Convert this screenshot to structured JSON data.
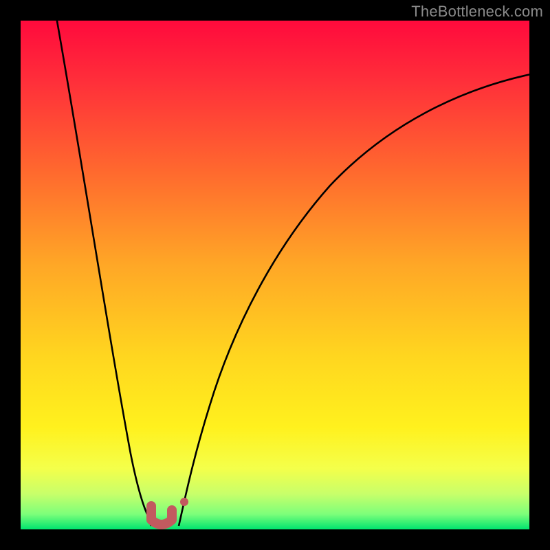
{
  "watermark": "TheBottleneck.com",
  "chart_data": {
    "type": "line",
    "title": "",
    "xlabel": "",
    "ylabel": "",
    "xlim": [
      0,
      100
    ],
    "ylim": [
      0,
      100
    ],
    "grid": false,
    "legend": null,
    "annotations": [],
    "background": {
      "style": "vertical-gradient",
      "meaning": "bottleneck severity (top=red=high, bottom=green=none)",
      "stops": [
        {
          "pos": 0.0,
          "color": "#ff0a3c"
        },
        {
          "pos": 0.12,
          "color": "#ff2f3a"
        },
        {
          "pos": 0.3,
          "color": "#ff6a2e"
        },
        {
          "pos": 0.48,
          "color": "#ffa726"
        },
        {
          "pos": 0.66,
          "color": "#ffd61f"
        },
        {
          "pos": 0.8,
          "color": "#fff11e"
        },
        {
          "pos": 0.88,
          "color": "#f4ff4a"
        },
        {
          "pos": 0.93,
          "color": "#c8ff6a"
        },
        {
          "pos": 0.97,
          "color": "#7dff7a"
        },
        {
          "pos": 1.0,
          "color": "#00e46f"
        }
      ]
    },
    "series": [
      {
        "name": "bottleneck-curve-left",
        "color": "#000000",
        "x": [
          7,
          9,
          11,
          13,
          15,
          17,
          19,
          21,
          23,
          25,
          26
        ],
        "values": [
          100,
          88,
          76,
          64,
          52,
          41,
          30,
          21,
          13,
          6,
          1
        ]
      },
      {
        "name": "bottleneck-curve-right",
        "color": "#000000",
        "x": [
          31,
          34,
          38,
          43,
          49,
          56,
          64,
          73,
          83,
          92,
          100
        ],
        "values": [
          1,
          8,
          17,
          28,
          40,
          52,
          63,
          73,
          81,
          86,
          90
        ]
      }
    ],
    "markers": [
      {
        "name": "optimal-range-left",
        "shape": "round-cap",
        "color": "#c25a5f",
        "x": 26,
        "y": 3
      },
      {
        "name": "optimal-range-right",
        "shape": "round-cap",
        "color": "#c25a5f",
        "x": 30,
        "y": 3
      },
      {
        "name": "marker-dot",
        "shape": "circle",
        "color": "#c25a5f",
        "x": 32,
        "y": 5
      }
    ]
  }
}
